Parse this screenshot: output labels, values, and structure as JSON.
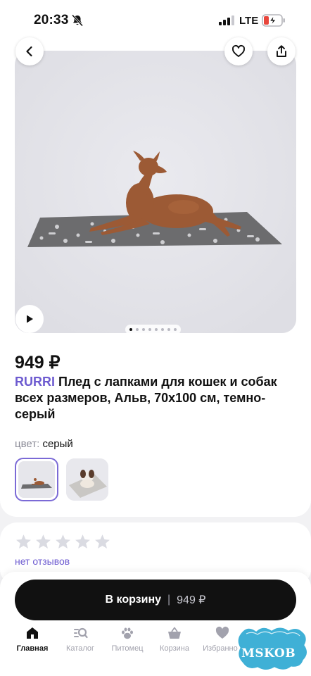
{
  "status_bar": {
    "time": "20:33",
    "network": "LTE"
  },
  "product": {
    "price": "949 ₽",
    "brand": "RURRI",
    "title": "Плед с лапками для кошек и собак всех размеров, Альв, 70x100 см, темно-серый",
    "color_key": "цвет:",
    "color_value": "серый"
  },
  "gallery": {
    "dot_count": 8,
    "active_dot": 0
  },
  "reviews": {
    "stars": 5,
    "rating": 0,
    "summary": "нет отзывов"
  },
  "cart_button": {
    "label": "В корзину",
    "separator": "|",
    "price": "949 ₽"
  },
  "tabbar": {
    "items": [
      {
        "label": "Главная",
        "icon": "home-icon",
        "active": true
      },
      {
        "label": "Каталог",
        "icon": "catalog-search-icon",
        "active": false
      },
      {
        "label": "Питомец",
        "icon": "paw-icon",
        "active": false
      },
      {
        "label": "Корзина",
        "icon": "basket-icon",
        "active": false
      },
      {
        "label": "Избранное",
        "icon": "heart-icon",
        "active": false
      }
    ]
  },
  "watermark": {
    "text": "MSKOB"
  },
  "colors": {
    "accent": "#6d5bd0",
    "button": "#111111",
    "inactive": "#a2a2ad"
  }
}
